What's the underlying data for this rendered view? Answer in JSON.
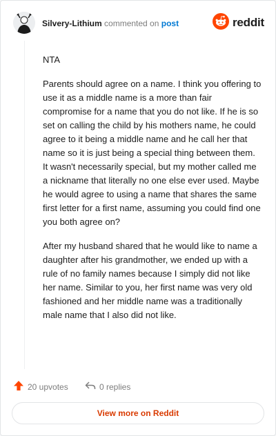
{
  "header": {
    "username": "Silvery-Lithium",
    "commented_on": "commented on",
    "post_link": "post",
    "brand_name": "reddit"
  },
  "comment": {
    "paragraphs": [
      "NTA",
      "Parents should agree on a name. I think you offering to use it as a middle name is a more than fair compromise for a name that you do not like. If he is so set on calling the child by his mothers name, he could agree to it being a middle name and he call her that name so it is just being a special thing between them. It wasn't necessarily special, but my mother called me a nickname that literally no one else ever used. Maybe he would agree to using a name that shares the same first letter for a first name, assuming you could find one you both agree on?",
      "After my husband shared that he would like to name a daughter after his grandmother, we ended up with a rule of no family names because I simply did not like her name. Similar to you, her first name was very old fashioned and her middle name was a traditionally male name that I also did not like."
    ]
  },
  "footer": {
    "upvotes": "20 upvotes",
    "replies": "0 replies",
    "view_more": "View more on Reddit"
  },
  "colors": {
    "accent": "#ff4500",
    "link": "#0079d3",
    "view_more": "#d93a00"
  },
  "icons": [
    "avatar",
    "reddit-logo-icon",
    "upvote-arrow-icon",
    "reply-arrow-icon"
  ]
}
